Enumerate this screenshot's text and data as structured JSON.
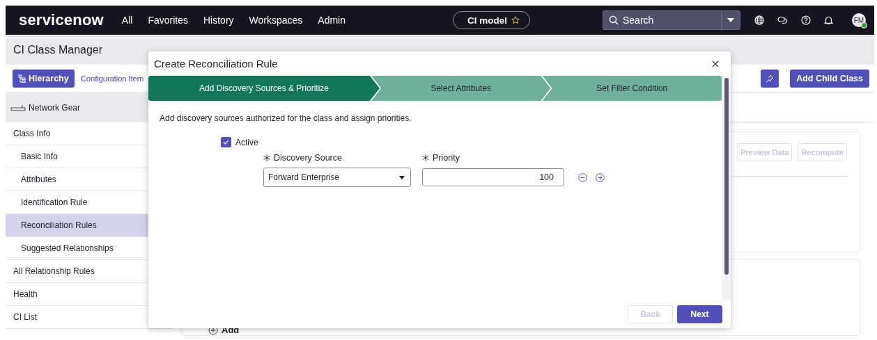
{
  "nav": {
    "logo": "servicenow",
    "menu": [
      {
        "label": "All"
      },
      {
        "label": "Favorites"
      },
      {
        "label": "History"
      },
      {
        "label": "Workspaces"
      },
      {
        "label": "Admin"
      }
    ],
    "context_pill": "CI model",
    "search": {
      "placeholder": "Search"
    },
    "avatar": "FM"
  },
  "header": {
    "title": "CI Class Manager"
  },
  "toolbar": {
    "hierarchy_button": "Hierarchy",
    "breadcrumb": "Configuration Item",
    "add_child_button": "Add Child Class"
  },
  "sidebar": {
    "class_name": "Network Gear",
    "items": [
      {
        "label": "Class Info",
        "selected": false,
        "children": [
          {
            "label": "Basic Info",
            "selected": false
          },
          {
            "label": "Attributes",
            "selected": false
          },
          {
            "label": "Identification Rule",
            "selected": false
          },
          {
            "label": "Reconciliation Rules",
            "selected": true
          },
          {
            "label": "Suggested Relationships",
            "selected": false
          }
        ]
      },
      {
        "label": "All Relationship Rules",
        "selected": false
      },
      {
        "label": "Health",
        "selected": false
      },
      {
        "label": "CI List",
        "selected": false
      }
    ]
  },
  "content": {
    "buttons": [
      {
        "label": "Preview Data",
        "disabled": true
      },
      {
        "label": "Recompute",
        "disabled": true
      }
    ],
    "add_link": "Add"
  },
  "modal": {
    "title": "Create Reconciliation Rule",
    "steps": [
      {
        "label": "Add Discovery Sources & Prioritize",
        "selected": true
      },
      {
        "label": "Select Attributes",
        "selected": false
      },
      {
        "label": "Set Filter Condition",
        "selected": false
      }
    ],
    "description": "Add discovery sources authorized for the class and assign priorities.",
    "active": {
      "label": "Active",
      "checked": true
    },
    "source": {
      "label": "Discovery Source",
      "value": "Forward Enterprise"
    },
    "priority": {
      "label": "Priority",
      "value": "100"
    },
    "buttons": [
      {
        "label": "Back",
        "disabled": true
      },
      {
        "label": "Next",
        "disabled": false
      }
    ]
  }
}
